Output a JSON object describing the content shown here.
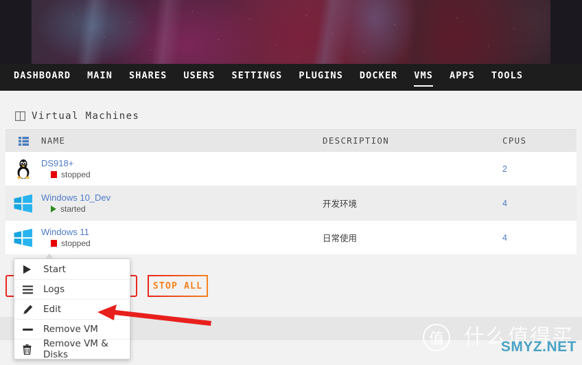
{
  "banner": {
    "alt": "decorative-anime-artwork-banner"
  },
  "nav": {
    "items": [
      {
        "label": "DASHBOARD",
        "active": false
      },
      {
        "label": "MAIN",
        "active": false
      },
      {
        "label": "SHARES",
        "active": false
      },
      {
        "label": "USERS",
        "active": false
      },
      {
        "label": "SETTINGS",
        "active": false
      },
      {
        "label": "PLUGINS",
        "active": false
      },
      {
        "label": "DOCKER",
        "active": false
      },
      {
        "label": "VMS",
        "active": true
      },
      {
        "label": "APPS",
        "active": false
      },
      {
        "label": "TOOLS",
        "active": false
      }
    ]
  },
  "panel": {
    "title": "Virtual Machines",
    "icon": "panel-split-icon"
  },
  "table": {
    "header_icon": "list-view-icon",
    "columns": [
      "NAME",
      "DESCRIPTION",
      "CPUS"
    ],
    "rows": [
      {
        "os_icon": "linux-penguin-icon",
        "name": "DS918+",
        "state": "stopped",
        "state_kind": "stopped",
        "description": "",
        "cpus": "2"
      },
      {
        "os_icon": "windows-logo-icon",
        "name": "Windows 10_Dev",
        "state": "started",
        "state_kind": "started",
        "description": "开发环境",
        "cpus": "4"
      },
      {
        "os_icon": "windows-logo-icon",
        "name": "Windows 11",
        "state": "stopped",
        "state_kind": "stopped",
        "description": "日常使用",
        "cpus": "4"
      }
    ]
  },
  "actions": {
    "start_all": "",
    "stop_all": "STOP ALL"
  },
  "context_menu": {
    "items": [
      {
        "label": "Start",
        "icon": "play-icon"
      },
      {
        "label": "Logs",
        "icon": "lines-icon"
      },
      {
        "label": "Edit",
        "icon": "pencil-icon"
      },
      {
        "label": "Remove VM",
        "icon": "minus-icon"
      },
      {
        "label": "Remove VM & Disks",
        "icon": "trash-icon"
      }
    ]
  },
  "annotation": {
    "arrow": "red-left-pointing-arrow",
    "color": "#e8201d"
  },
  "watermark": {
    "badge_char": "值",
    "chinese": "什么值得买",
    "site": "SMYZ.NET",
    "site_color": "#4aa3c4"
  },
  "colors": {
    "nav_bg": "#1d1d1d",
    "link_blue": "#4e7ac7",
    "stopped_red": "#e60000",
    "started_green": "#2e8b1f",
    "btn_red": "#e8261d",
    "btn_orange": "#f5821f"
  }
}
